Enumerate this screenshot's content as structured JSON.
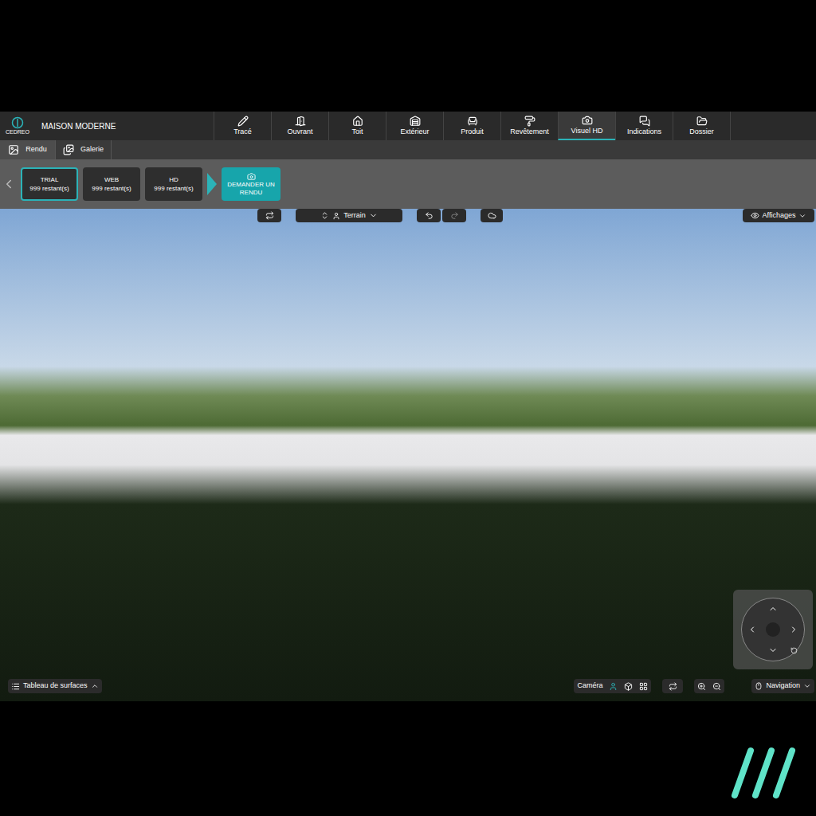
{
  "app": {
    "logo": "CEDREO",
    "project": "MAISON MODERNE"
  },
  "toolbar": [
    {
      "label": "Tracé",
      "selected": false
    },
    {
      "label": "Ouvrant",
      "selected": false
    },
    {
      "label": "Toit",
      "selected": false
    },
    {
      "label": "Extérieur",
      "selected": false
    },
    {
      "label": "Produit",
      "selected": false
    },
    {
      "label": "Revêtement",
      "selected": false
    },
    {
      "label": "Visuel HD",
      "selected": true
    },
    {
      "label": "Indications",
      "selected": false
    },
    {
      "label": "Dossier",
      "selected": false
    }
  ],
  "tabs": [
    {
      "label": "Rendu",
      "selected": true
    },
    {
      "label": "Galerie",
      "selected": false
    }
  ],
  "render_options": [
    {
      "label": "TRIAL",
      "remaining": "999 restant(s)",
      "selected": true
    },
    {
      "label": "WEB",
      "remaining": "999 restant(s)",
      "selected": false
    },
    {
      "label": "HD",
      "remaining": "999 restant(s)",
      "selected": false
    }
  ],
  "request_button": "DEMANDER UN RENDU",
  "viewport": {
    "level_select": "Terrain",
    "display_button": "Affichages"
  },
  "status_bar": {
    "surfaces": "Tableau de surfaces",
    "camera": "Caméra",
    "navigation": "Navigation"
  }
}
